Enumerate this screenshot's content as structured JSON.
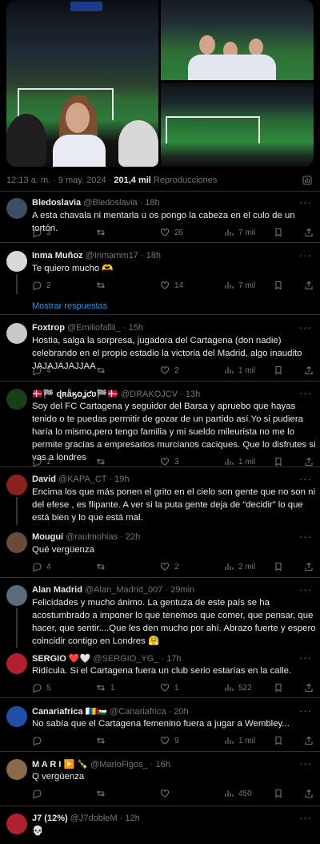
{
  "tweet": {
    "time": "12:13 a. m.",
    "sep": "·",
    "date": "9 may. 2024",
    "views_count": "201,4 mil",
    "views_label": "Reproducciones"
  },
  "replies": [
    {
      "name": "Bledoslavia",
      "handle": "@Bledoslavia",
      "age": "· 18h",
      "text": "A esta chavala ni mentarla u os pongo la cabeza en el culo de un tortón.",
      "replies": "3",
      "retweets": "",
      "likes": "26",
      "views": "7 mil",
      "avatar_color": "#3a4f63"
    },
    {
      "name": "Inma Muñoz",
      "handle": "@Inmamm17",
      "age": "· 18h",
      "text": "Te quiero mucho 🫶",
      "replies": "2",
      "retweets": "",
      "likes": "14",
      "views": "7 mil",
      "avatar_color": "#d9d9d9"
    },
    {
      "name": "Foxtrop",
      "handle": "@Emiliofafiii_",
      "age": "· 15h",
      "text": "Hostia, salga la sorpresa, jugadora del Cartagena (don nadie) celebrando en el propio estadio la victoria del Madrid, algo inaudito JAJAJAJAJJAA",
      "replies": "4",
      "retweets": "",
      "likes": "2",
      "views": "1 mil",
      "avatar_color": "#c9c9c9"
    },
    {
      "name": "🇩🇰🏁 ɖʀǟӄօʝƈʋ🏁🇩🇰",
      "handle": "@DRAKOJCV",
      "age": "· 13h",
      "text": "Soy del FC Cartagena y seguidor del Barsa y apruebo que hayas tenido o te puedas permitir de gozar de un partido así.Yo si pudiera haría lo mismo,pero tengo familia y mi sueldo mileurista no me lo permite gracias a empresarios murcianos caciques. Que lo disfrutes si vas a londres",
      "replies": "1",
      "retweets": "",
      "likes": "3",
      "views": "1 mil",
      "avatar_color": "#1a3d1a"
    },
    {
      "name": "David",
      "handle": "@KAPA_CT",
      "age": "· 19h",
      "text": "Encima los que más ponen el grito en el cielo son gente que no son ni del efese , es flipante. A ver si la puta gente deja de “decidir” lo que está bien y lo que está mal.",
      "replies": "",
      "retweets": "",
      "likes": "",
      "views": "",
      "avatar_color": "#8b2020"
    },
    {
      "name": "Mougui",
      "handle": "@raulmohias",
      "age": "· 22h",
      "text": "Qué vergüenza",
      "replies": "4",
      "retweets": "",
      "likes": "2",
      "views": "2 mil",
      "avatar_color": "#6b4a3a"
    },
    {
      "name": "Alan Madrid",
      "handle": "@Alan_Madrid_007",
      "age": "· 29min",
      "text": "Felicidades y mucho ánimo. La gentuza de este país se ha acostumbrado a imponer lo que tenemos que comer, que pensar, que hacer, que sentir....Que les den mucho por ahí. Abrazo fuerte y espero coincidir contigo en Londres 🤗",
      "replies": "",
      "retweets": "",
      "likes": "",
      "views": "",
      "avatar_color": "#5a6b7a"
    },
    {
      "name": "SERGIO ❤️🤍",
      "handle": "@SERGIO_YG_",
      "age": "· 17h",
      "text": "Ridícula. Si el Cartagena fuera un club serio estarías en la calle.",
      "replies": "5",
      "retweets": "1",
      "likes": "1",
      "views": "522",
      "avatar_color": "#b02030"
    },
    {
      "name": "Canariafrica 🇮🇨🇪🇭",
      "handle": "@Canariafrica",
      "age": "· 20h",
      "text": "No sabía que el Cartagena femenino fuera a jugar a Wembley...",
      "replies": "",
      "retweets": "",
      "likes": "9",
      "views": "1 mil",
      "avatar_color": "#1f4fa8"
    },
    {
      "name": "M A R I ▶️ 🍾",
      "handle": "@MarioFigos_",
      "age": "· 16h",
      "text": "Q vergüenza",
      "replies": "",
      "retweets": "",
      "likes": "",
      "views": "450",
      "avatar_color": "#8a6a4a"
    },
    {
      "name": "J7 (12%)",
      "handle": "@J7dobleM",
      "age": "· 12h",
      "text": "💀",
      "replies": "",
      "retweets": "",
      "likes": "",
      "views": "",
      "avatar_color": "#b02030"
    }
  ],
  "show_replies": "Mostrar respuestas",
  "more_glyph": "···",
  "icons": [
    "reply-icon",
    "retweet-icon",
    "like-icon",
    "views-icon",
    "bookmark-icon",
    "share-icon"
  ]
}
